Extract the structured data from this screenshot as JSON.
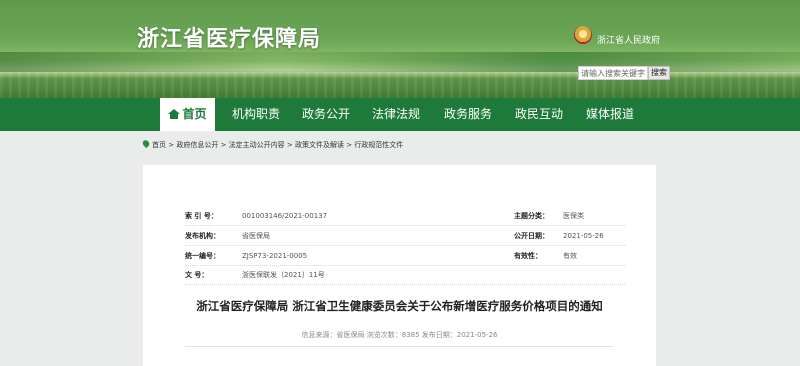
{
  "header": {
    "site_title": "浙江省医疗保障局",
    "gov_link": "浙江省人民政府",
    "search_placeholder": "请输入搜索关键字",
    "search_button": "搜索"
  },
  "nav": {
    "items": [
      "首页",
      "机构职责",
      "政务公开",
      "法律法规",
      "政务服务",
      "政民互动",
      "媒体报道"
    ]
  },
  "breadcrumb": {
    "items": [
      "首页",
      "政府信息公开",
      "法定主动公开内容",
      "政策文件及解读",
      "行政规范性文件"
    ],
    "separator": " > "
  },
  "meta": {
    "rows": [
      {
        "label": "索 引 号：",
        "value": "001003146/2021-00137",
        "label2": "主题分类：",
        "value2": "医保类"
      },
      {
        "label": "发布机构：",
        "value": "省医保局",
        "label2": "公开日期：",
        "value2": "2021-05-26"
      },
      {
        "label": "统一编号：",
        "value": "ZJSP73-2021-0005",
        "label2": "有效性：",
        "value2": "有效"
      },
      {
        "label": "文    号：",
        "value": "浙医保联发〔2021〕11号",
        "label2": "",
        "value2": ""
      }
    ]
  },
  "document": {
    "title": "浙江省医疗保障局 浙江省卫生健康委员会关于公布新增医疗服务价格项目的通知",
    "info": "信息来源：省医保局  浏览次数：8385  发布日期：2021-05-26"
  }
}
